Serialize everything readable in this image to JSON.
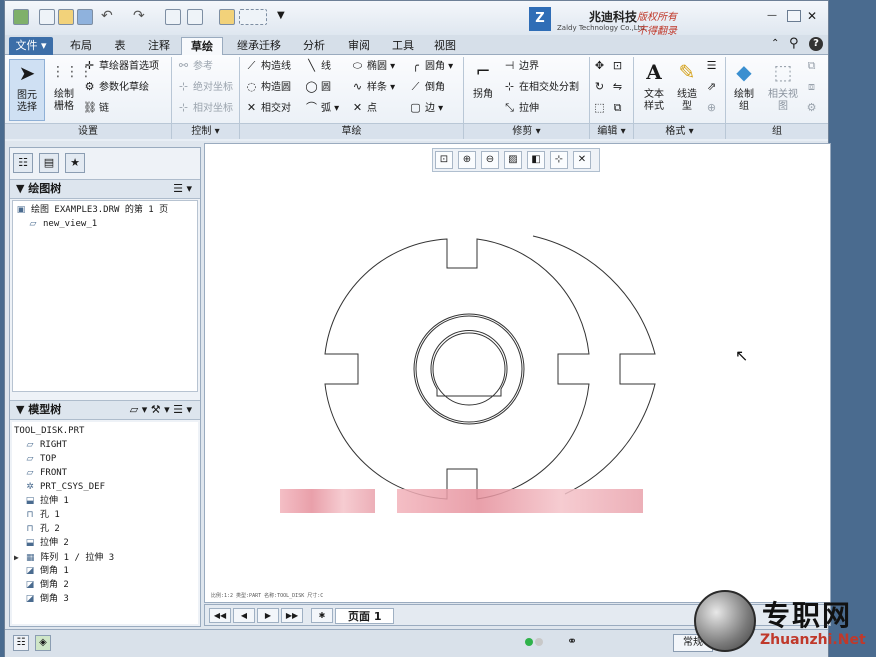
{
  "brand": {
    "logo": "Z",
    "name_cn": "兆迪科技",
    "name_en": "Zaldy Technology Co.,Ltd.",
    "rights1": "版权所有",
    "rights2": "不得翻录"
  },
  "tabs": [
    "文件 ▾",
    "布局",
    "表",
    "注释",
    "草绘",
    "继承迁移",
    "分析",
    "审阅",
    "工具",
    "视图"
  ],
  "ribbon": {
    "select_label": "图元\n选择",
    "grid_label": "绘制\n栅格",
    "sketch_prefs": "草绘器首选项",
    "param_sketch": "参数化草绘",
    "chain": "链",
    "reference": "参考",
    "abs_coord": "绝对坐标",
    "rel_coord": "相对坐标",
    "construct_line": "构造线",
    "construct_circle": "构造圆",
    "intersect": "相交对",
    "line": "线",
    "circle": "圆",
    "arc": "弧",
    "ellipse": "椭圆",
    "spline": "样条",
    "point": "点",
    "fillet": "圆角",
    "chamfer": "倒角",
    "edge": "边",
    "corner": "拐角",
    "boundary": "边界",
    "divide": "在相交处分割",
    "stretch": "拉伸",
    "text_style": "文本\n样式",
    "line_style": "线造\n型",
    "draw_group": "绘制\n组",
    "related_view": "相关视\n图"
  },
  "groups": [
    "设置",
    "控制 ▾",
    "草绘",
    "修剪 ▾",
    "编辑 ▾",
    "格式 ▾",
    "组"
  ],
  "drawing_tree": {
    "title": "绘图树",
    "root": "绘图 EXAMPLE3.DRW 的第 1 页",
    "child": "new_view_1"
  },
  "model_tree": {
    "title": "模型树",
    "items": [
      {
        "icon": "part-icon",
        "label": "TOOL_DISK.PRT"
      },
      {
        "icon": "datum-plane-icon",
        "label": "RIGHT"
      },
      {
        "icon": "datum-plane-icon",
        "label": "TOP"
      },
      {
        "icon": "datum-plane-icon",
        "label": "FRONT"
      },
      {
        "icon": "csys-icon",
        "label": "PRT_CSYS_DEF"
      },
      {
        "icon": "extrude-icon",
        "label": "拉伸 1"
      },
      {
        "icon": "hole-icon",
        "label": "孔 1"
      },
      {
        "icon": "hole-icon",
        "label": "孔 2"
      },
      {
        "icon": "extrude-icon",
        "label": "拉伸 2"
      },
      {
        "icon": "pattern-icon",
        "label": "阵列 1 / 拉伸 3"
      },
      {
        "icon": "chamfer-icon",
        "label": "倒角 1"
      },
      {
        "icon": "chamfer-icon",
        "label": "倒角 2"
      },
      {
        "icon": "chamfer-icon",
        "label": "倒角 3"
      }
    ]
  },
  "canvas_status": "比例:1:2   类型:PART   名称:TOOL_DISK   尺寸:C",
  "pager": {
    "page_label": "页面 1"
  },
  "statusbar": {
    "mode": "常规"
  },
  "watermark": {
    "cn": "专职网",
    "en": "Zhuanzhi.Net"
  }
}
